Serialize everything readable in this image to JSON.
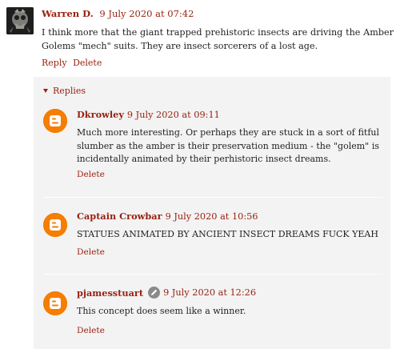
{
  "comment": {
    "author": "Warren D.",
    "timestamp": "9 July 2020 at 07:42",
    "text": "I think more that the giant trapped prehistoric insects are driving the Amber Golems \"mech\" suits. They are insect sorcerers of a lost age.",
    "reply_label": "Reply",
    "delete_label": "Delete"
  },
  "replies": {
    "toggle_label": "Replies",
    "items": [
      {
        "author": "Dkrowley",
        "timestamp": "9 July 2020 at 09:11",
        "text": "Much more interesting. Or perhaps they are stuck in a sort of fitful slumber as the amber is their preservation medium - the \"golem\" is incidentally animated by their perhistoric insect dreams.",
        "delete_label": "Delete"
      },
      {
        "author": "Captain Crowbar",
        "timestamp": "9 July 2020 at 10:56",
        "text": "STATUES ANIMATED BY ANCIENT INSECT DREAMS FUCK YEAH",
        "delete_label": "Delete"
      },
      {
        "author": "pjamesstuart",
        "timestamp": "9 July 2020 at 12:26",
        "text": "This concept does seem like a winner.",
        "delete_label": "Delete",
        "badge_icon": "pencil-icon"
      }
    ]
  },
  "colors": {
    "link": "#992211",
    "replies_background": "#f3f3f3",
    "blogger_orange": "#f57d00"
  }
}
